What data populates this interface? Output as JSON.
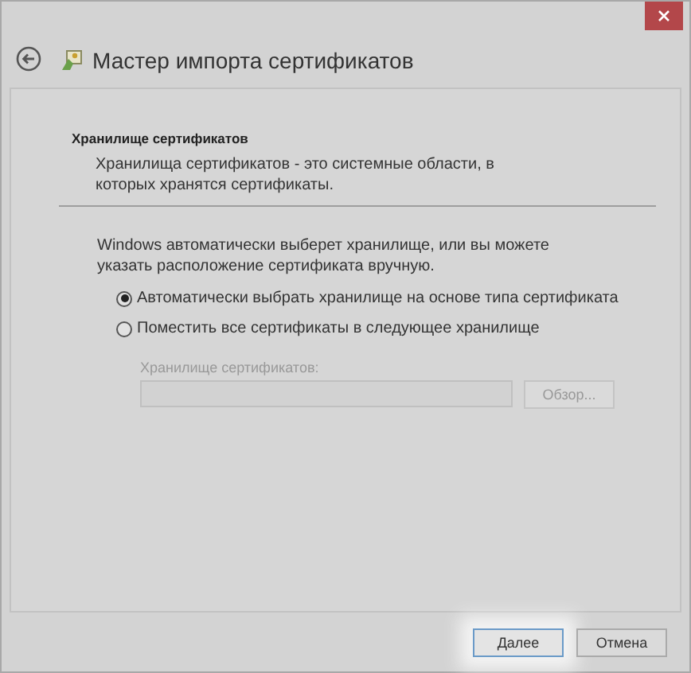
{
  "window": {
    "title": "Мастер импорта сертификатов"
  },
  "header": {
    "title": "Хранилище сертификатов",
    "description": "Хранилища сертификатов - это системные области, в которых хранятся сертификаты."
  },
  "intro": "Windows автоматически выберет хранилище, или вы можете указать расположение сертификата вручную.",
  "options": [
    {
      "label": "Автоматически выбрать хранилище на основе типа сертификата",
      "selected": true
    },
    {
      "label": "Поместить все сертификаты в следующее хранилище",
      "selected": false
    }
  ],
  "store": {
    "label": "Хранилище сертификатов:",
    "disabled": true,
    "browse": "Обзор..."
  },
  "buttons": [
    {
      "label": "Далее",
      "focused": true
    },
    {
      "label": "Отмена",
      "focused": false
    }
  ]
}
